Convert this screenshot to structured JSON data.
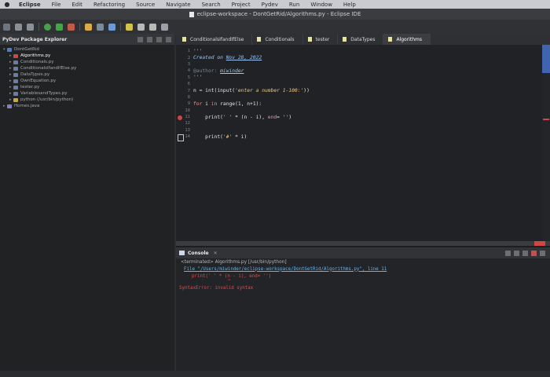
{
  "menubar": {
    "app": "Eclipse",
    "items": [
      "File",
      "Edit",
      "Refactoring",
      "Source",
      "Navigate",
      "Search",
      "Project",
      "Pydev",
      "Run",
      "Window",
      "Help"
    ]
  },
  "window": {
    "title": "eclipse-workspace - DontGetRid/Algorithms.py - Eclipse IDE"
  },
  "explorer": {
    "title": "PyDev Package Explorer",
    "items": [
      {
        "label": "DontGetRid",
        "level": 0
      },
      {
        "label": "Algorithms.py",
        "level": 1
      },
      {
        "label": "Conditionals.py",
        "level": 1
      },
      {
        "label": "ConditionalsIfandIfElse.py",
        "level": 1
      },
      {
        "label": "DataTypes.py",
        "level": 1
      },
      {
        "label": "OwnEquation.py",
        "level": 1
      },
      {
        "label": "tester.py",
        "level": 1
      },
      {
        "label": "VariablesandTypes.py",
        "level": 1
      },
      {
        "label": "python (/usr/bin/python)",
        "level": 1
      },
      {
        "label": "Homes.java",
        "level": 0
      }
    ]
  },
  "tabs": [
    {
      "label": "ConditionalsIfandIfElse",
      "active": false
    },
    {
      "label": "Conditionals",
      "active": false
    },
    {
      "label": "tester",
      "active": false
    },
    {
      "label": "DataTypes",
      "active": false
    },
    {
      "label": "Algorithms",
      "active": true
    }
  ],
  "editor": {
    "line_numbers": [
      "1",
      "2",
      "3",
      "4",
      "5",
      "6",
      "7",
      "8",
      "9",
      "10",
      "11",
      "12",
      "13",
      "14"
    ],
    "created_label": "Created on ",
    "created_date": "Nov 28, 2022",
    "author_tag": "@author: ",
    "author_name": "miwinder",
    "docquote": "'''",
    "line7_a": "n = int(input(",
    "line7_str": "'enter a number 1-100:'",
    "line7_b": "))",
    "line9_kw1": "for",
    "line9_a": " i ",
    "line9_kw2": "in",
    "line9_b": " range(1, n+1):",
    "line11_a": "    print(",
    "line11_str": "' '",
    "line11_b": " * (n - i), ",
    "line11_kw": "end",
    "line11_c": "= ",
    "line11_str2": "''",
    "line11_d": ")",
    "line14_a": "    print(",
    "line14_str": "'#'",
    "line14_b": " * i)"
  },
  "console": {
    "title": "Console",
    "terminated": "<terminated> Algorithms.py [/usr/bin/python]",
    "file_link": "File \"/Users/miwinder/eclipse-workspace/DontGetRid/Algorithms.py\", line 11",
    "error_code": "print(' ' * (n - i), end= '')",
    "caret": "^",
    "error_msg": "SyntaxError: invalid syntax"
  },
  "colors": {
    "accent_error": "#e24c4c",
    "link": "#5fb5f7",
    "docstring": "#9fc7f2"
  }
}
